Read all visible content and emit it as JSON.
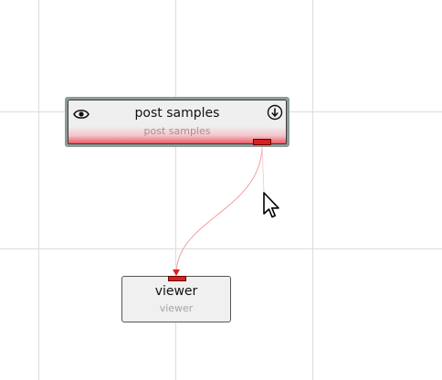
{
  "nodes": {
    "post_samples": {
      "title": "post samples",
      "subtitle": "post samples",
      "icons": {
        "left": "eye-icon",
        "right": "download-icon"
      }
    },
    "viewer": {
      "title": "viewer",
      "subtitle": "viewer"
    }
  },
  "colors": {
    "grid": "#dcdcdc",
    "port": "#d62222",
    "wire": "#f1a0a5",
    "node_fill": "#efefef",
    "selection_border": "#8f9b95"
  },
  "connections": [
    {
      "from": "post_samples.output",
      "to": "viewer.input"
    }
  ]
}
